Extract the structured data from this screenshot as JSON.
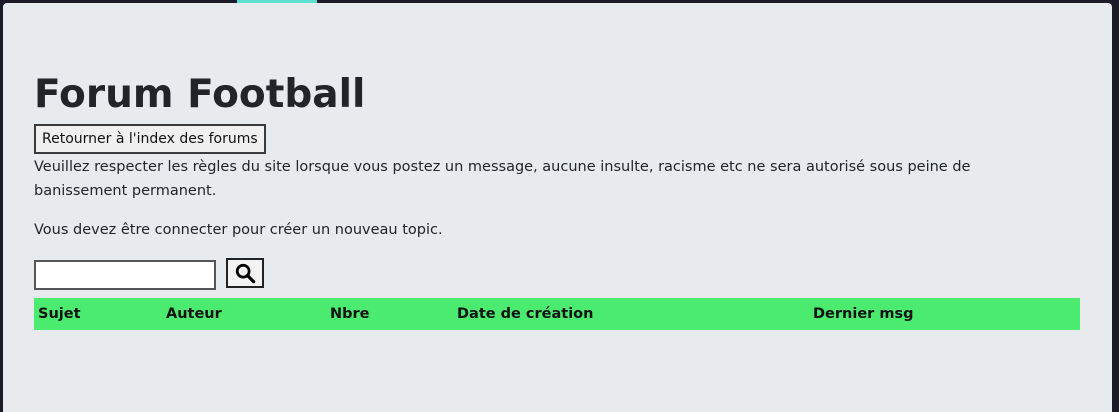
{
  "page": {
    "title": "Forum Football",
    "back_button_label": "Retourner à l'index des forums",
    "rules_text": "Veuillez respecter les règles du site lorsque vous postez un message, aucune insulte, racisme etc ne sera autorisé sous peine de banissement permanent.",
    "login_notice": "Vous devez être connecter pour créer un nouveau topic."
  },
  "search": {
    "value": "",
    "placeholder": "",
    "button_icon": "search-icon"
  },
  "table": {
    "columns": [
      "Sujet",
      "Auteur",
      "Nbre",
      "Date de création",
      "Dernier msg"
    ],
    "rows": []
  },
  "colors": {
    "background": "#1c1a28",
    "panel": "#e7ebee",
    "accent": "#5ee0d0",
    "table_header": "#4aeb6e",
    "text": "#212529"
  }
}
